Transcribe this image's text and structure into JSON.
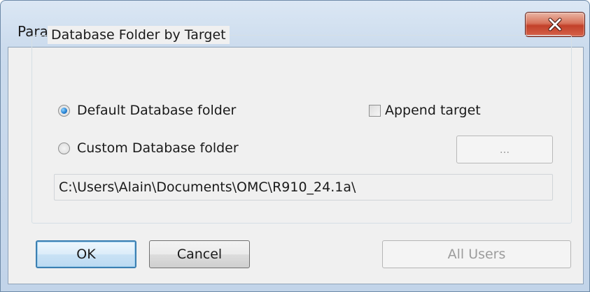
{
  "window": {
    "title": "Parameters",
    "close_icon": "close-x-icon"
  },
  "group": {
    "title": "Database Folder by Target",
    "default_option": {
      "label": "Default Database folder",
      "selected": true
    },
    "custom_option": {
      "label": "Custom Database folder",
      "selected": false
    },
    "append_target": {
      "label": "Append target",
      "checked": false
    },
    "browse_label": "...",
    "path_value": "C:\\Users\\Alain\\Documents\\OMC\\R910_24.1a\\"
  },
  "buttons": {
    "ok": "OK",
    "cancel": "Cancel",
    "all_users": "All Users"
  },
  "colors": {
    "title_bar": "#cbdbed",
    "close_button": "#c2412a",
    "default_button_border": "#3c7fb1",
    "disabled_text": "#9c9c9c"
  }
}
